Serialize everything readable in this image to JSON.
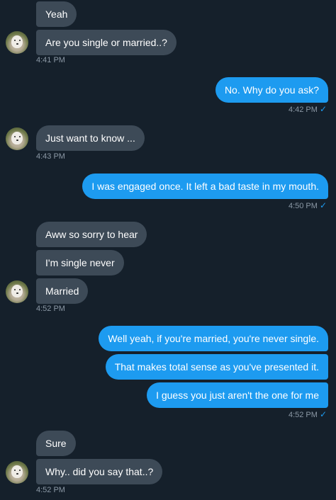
{
  "conversation": {
    "msg1": "Yeah",
    "msg2": "Are you single or married..?",
    "ts1": "4:41 PM",
    "msg3": "No. Why do you ask?",
    "ts2": "4:42 PM",
    "msg4": "Just want to know ...",
    "ts3": "4:43 PM",
    "msg5": "I was engaged once. It left a bad taste in my mouth.",
    "ts4": "4:50 PM",
    "msg6": "Aww so sorry to hear",
    "msg7": "I'm single never",
    "msg8": "Married",
    "ts5": "4:52 PM",
    "msg9": "Well yeah, if you're married, you're never single.",
    "msg10": "That makes total sense as you've presented it.",
    "msg11": "I guess you just aren't the one for me",
    "ts6": "4:52 PM",
    "msg12": "Sure",
    "msg13": "Why.. did you say that..?",
    "ts7": "4:52 PM"
  },
  "read_check": "✓",
  "colors": {
    "background": "#15202b",
    "incoming_bubble": "#3d4a57",
    "outgoing_bubble": "#1d9bf0",
    "timestamp": "#8b98a5"
  },
  "icons": {
    "avatar": "dog-avatar-icon",
    "read_receipt": "checkmark-icon"
  }
}
